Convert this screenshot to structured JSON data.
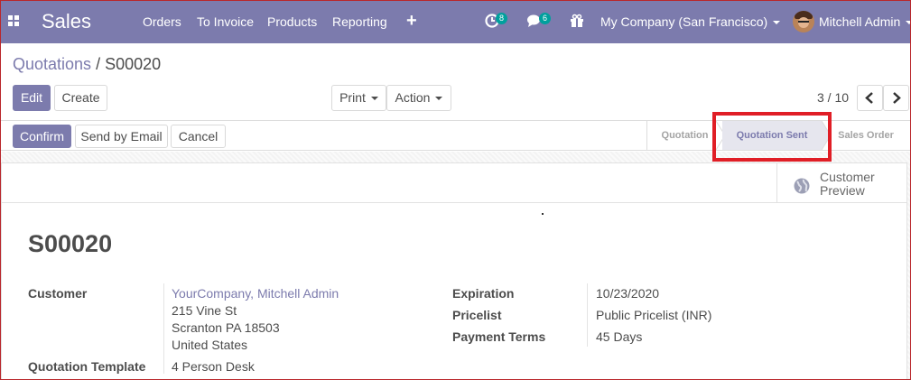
{
  "navbar": {
    "brand": "Sales",
    "menu": [
      "Orders",
      "To Invoice",
      "Products",
      "Reporting"
    ],
    "add_icon": "plus-icon",
    "activity_badge": "8",
    "messages_badge": "6",
    "company": "My Company (San Francisco)",
    "user": "Mitchell Admin"
  },
  "breadcrumb": {
    "parent": "Quotations",
    "separator": "/",
    "current": "S00020"
  },
  "buttons": {
    "edit": "Edit",
    "create": "Create",
    "print": "Print",
    "action": "Action"
  },
  "pager": {
    "value": "3 / 10"
  },
  "statusbar": {
    "confirm": "Confirm",
    "send_email": "Send by Email",
    "cancel": "Cancel",
    "stages": [
      "Quotation",
      "Quotation Sent",
      "Sales Order"
    ],
    "active_stage": "Quotation Sent"
  },
  "smart_button": {
    "line1": "Customer",
    "line2": "Preview",
    "icon": "globe-icon"
  },
  "record": {
    "name": "S00020"
  },
  "fields": {
    "customer_label": "Customer",
    "customer_name": "YourCompany, Mitchell Admin",
    "customer_street": "215 Vine St",
    "customer_city": "Scranton PA 18503",
    "customer_country": "United States",
    "template_label": "Quotation Template",
    "template_value": "4 Person Desk",
    "expiration_label": "Expiration",
    "expiration_value": "10/23/2020",
    "pricelist_label": "Pricelist",
    "pricelist_value": "Public Pricelist (INR)",
    "terms_label": "Payment Terms",
    "terms_value": "45 Days"
  },
  "colors": {
    "brand": "#7c7bad",
    "badge": "#00a09d",
    "highlight": "#e01e26"
  }
}
